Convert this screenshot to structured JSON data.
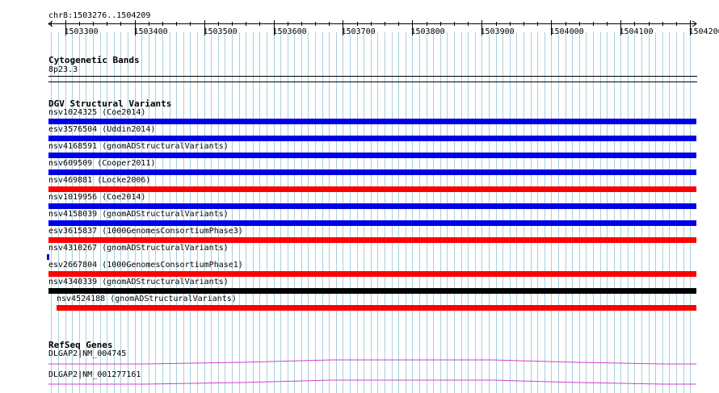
{
  "browser": {
    "region_label": "chr8:1503276..1504209",
    "ruler": {
      "start": 1503276,
      "end": 1504209,
      "ticks": [
        "1503300",
        "1503400",
        "1503500",
        "1503600",
        "1503700",
        "1503800",
        "1503900",
        "1504000",
        "1504100",
        "1504200"
      ],
      "tick_values": [
        1503300,
        1503400,
        1503500,
        1503600,
        1503700,
        1503800,
        1503900,
        1504000,
        1504100,
        1504200
      ]
    },
    "colors": {
      "grid": "#a8d0dc",
      "blue": "#0000e6",
      "red": "#ff0000",
      "black": "#000000",
      "magenta": "#d040d0",
      "text": "#000000"
    }
  },
  "tracks": {
    "cytoband": {
      "title": "Cytogenetic Bands",
      "band": "8p23.3"
    },
    "dgv": {
      "title": "DGV Structural Variants",
      "items": [
        {
          "label": "nsv1024325 (Coe2014)",
          "color": "blue"
        },
        {
          "label": "esv3576504 (Uddin2014)",
          "color": "blue"
        },
        {
          "label": "nsv4168591 (gnomADStructuralVariants)",
          "color": "blue"
        },
        {
          "label": "nsv609509 (Cooper2011)",
          "color": "blue"
        },
        {
          "label": "nsv469881 (Locke2006)",
          "color": "red"
        },
        {
          "label": "nsv1019956 (Coe2014)",
          "color": "blue"
        },
        {
          "label": "nsv4158039 (gnomADStructuralVariants)",
          "color": "blue"
        },
        {
          "label": "esv3615837 (1000GenomesConsortiumPhase3)",
          "color": "red"
        },
        {
          "label": "nsv4310267 (gnomADStructuralVariants)",
          "color": "blue"
        },
        {
          "label": "esv2667804 (1000GenomesConsortiumPhase1)",
          "color": "red"
        },
        {
          "label": "nsv4340339 (gnomADStructuralVariants)",
          "color": "black"
        },
        {
          "label": "nsv4524188 (gnomADStructuralVariants)",
          "color": "red"
        }
      ]
    },
    "refseq": {
      "title": "RefSeq Genes",
      "genes": [
        {
          "label": "DLGAP2|NM_004745",
          "color": "magenta"
        },
        {
          "label": "DLGAP2|NM_001277161",
          "color": "magenta"
        }
      ]
    }
  }
}
